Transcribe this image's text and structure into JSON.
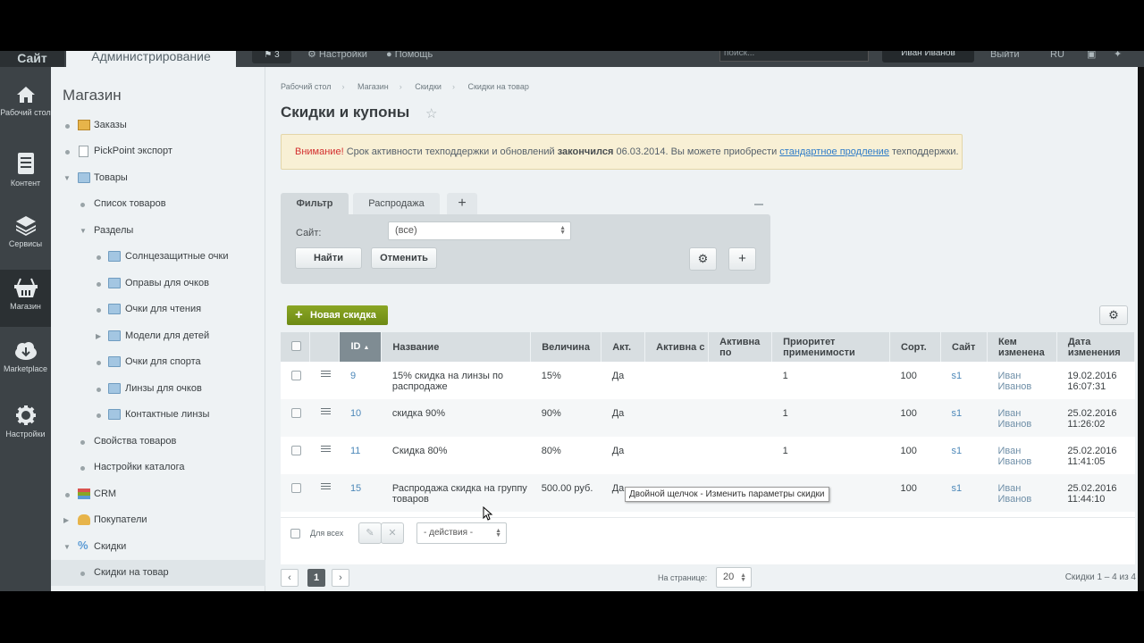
{
  "topbar": {
    "site": "Сайт",
    "admin": "Администрирование",
    "notifications": "3",
    "settings": "Настройки",
    "help": "Помощь",
    "search_placeholder": "поиск...",
    "user": "Иван Иванов",
    "logout": "Выйти",
    "lang": "RU"
  },
  "rail": [
    {
      "label": "Рабочий стол",
      "icon": "home-icon"
    },
    {
      "label": "Контент",
      "icon": "document-icon"
    },
    {
      "label": "Сервисы",
      "icon": "layers-icon"
    },
    {
      "label": "Магазин",
      "icon": "basket-icon"
    },
    {
      "label": "Marketplace",
      "icon": "cloud-download-icon"
    },
    {
      "label": "Настройки",
      "icon": "gear-icon"
    }
  ],
  "sidebar": {
    "title": "Магазин",
    "items": [
      {
        "label": "Заказы"
      },
      {
        "label": "PickPoint экспорт"
      },
      {
        "label": "Товары"
      },
      {
        "label": "Список товаров"
      },
      {
        "label": "Разделы"
      },
      {
        "label": "Солнцезащитные очки"
      },
      {
        "label": "Оправы для очков"
      },
      {
        "label": "Очки для чтения"
      },
      {
        "label": "Модели для детей"
      },
      {
        "label": "Очки для спорта"
      },
      {
        "label": "Линзы для очков"
      },
      {
        "label": "Контактные линзы"
      },
      {
        "label": "Свойства товаров"
      },
      {
        "label": "Настройки каталога"
      },
      {
        "label": "CRM"
      },
      {
        "label": "Покупатели"
      },
      {
        "label": "Скидки"
      },
      {
        "label": "Скидки на товар"
      }
    ]
  },
  "breadcrumb": [
    "Рабочий стол",
    "Магазин",
    "Скидки",
    "Скидки на товар"
  ],
  "page_title": "Скидки и купоны",
  "alert": {
    "prefix": "Внимание!",
    "text1": " Срок активности техподдержки и обновлений ",
    "bold": "закончился",
    "text2": " 06.03.2014. Вы можете приобрести ",
    "link": "стандартное продление",
    "text3": " техподдержки."
  },
  "filter": {
    "tabs": [
      "Фильтр",
      "Распродажа"
    ],
    "add_tab": "+",
    "site_label": "Сайт:",
    "site_value": "(все)",
    "find": "Найти",
    "cancel": "Отменить"
  },
  "grid": {
    "new_button": "Новая скидка",
    "columns": [
      "ID",
      "Название",
      "Величина",
      "Акт.",
      "Активна с",
      "Активна по",
      "Приоритет применимости",
      "Сорт.",
      "Сайт",
      "Кем изменена",
      "Дата изменения"
    ],
    "rows": [
      {
        "id": "9",
        "name": "15% скидка на линзы по распродаже",
        "value": "15%",
        "active": "Да",
        "from": "",
        "to": "",
        "priority": "1",
        "sort": "100",
        "site": "s1",
        "by": "Иван Иванов",
        "date": "19.02.2016 16:07:31"
      },
      {
        "id": "10",
        "name": "скидка 90%",
        "value": "90%",
        "active": "Да",
        "from": "",
        "to": "",
        "priority": "1",
        "sort": "100",
        "site": "s1",
        "by": "Иван Иванов",
        "date": "25.02.2016 11:26:02"
      },
      {
        "id": "11",
        "name": "Скидка 80%",
        "value": "80%",
        "active": "Да",
        "from": "",
        "to": "",
        "priority": "1",
        "sort": "100",
        "site": "s1",
        "by": "Иван Иванов",
        "date": "25.02.2016 11:41:05"
      },
      {
        "id": "15",
        "name": "Распродажа скидка на группу товаров",
        "value": "500.00 руб.",
        "active": "Да",
        "from": "",
        "to": "",
        "priority": "",
        "sort": "100",
        "site": "s1",
        "by": "Иван Иванов",
        "date": "25.02.2016 11:44:10"
      }
    ],
    "for_all": "Для всех",
    "actions": "- действия -"
  },
  "pager": {
    "page": "1",
    "per_page_label": "На странице:",
    "per_page": "20",
    "summary": "Скидки 1 – 4 из 4"
  },
  "tooltip": "Двойной щелчок - Изменить параметры скидки"
}
